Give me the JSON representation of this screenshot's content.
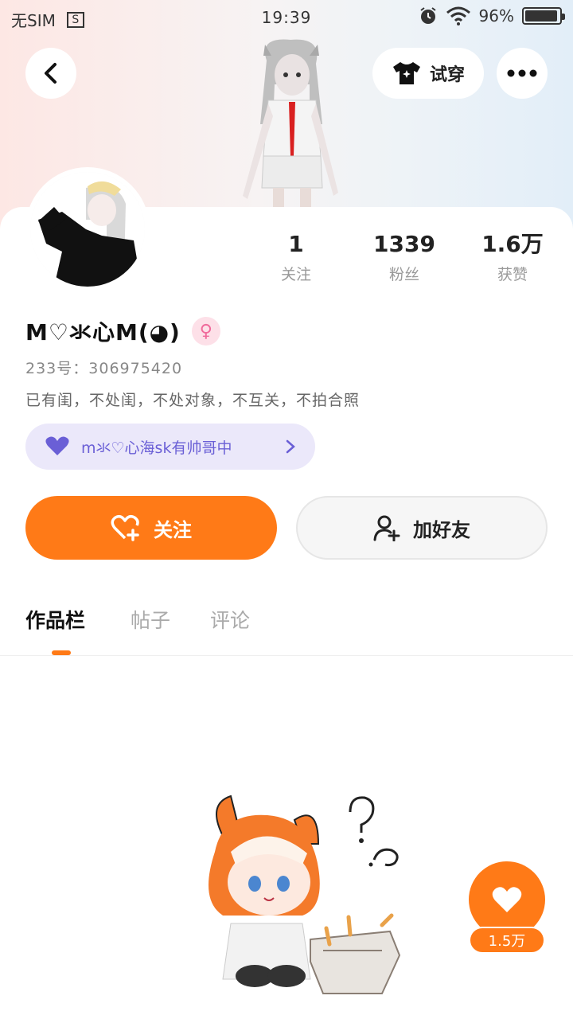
{
  "status_bar": {
    "sim": "无SIM",
    "time": "19:39",
    "battery": "96%"
  },
  "header": {
    "back_icon": "chevron-left-icon",
    "try_on_label": "试穿",
    "more_icon": "more-dots-icon"
  },
  "stats": [
    {
      "value": "1",
      "label": "关注"
    },
    {
      "value": "1339",
      "label": "粉丝"
    },
    {
      "value": "1.6万",
      "label": "获赞"
    }
  ],
  "profile": {
    "nickname": "M♡氺心M(◕)",
    "gender_icon": "female-icon",
    "uid": "233号：306975420",
    "bio": "已有闺，不处闺，不处对象，不互关，不拍合照",
    "fan_group": "m氺♡心海sk有帅哥中"
  },
  "actions": {
    "follow_label": "关注",
    "add_friend_label": "加好友"
  },
  "tabs": [
    "作品栏",
    "帖子",
    "评论"
  ],
  "like": {
    "count": "1.5万"
  },
  "colors": {
    "accent": "#ff7a17",
    "fan_pill_bg": "#ebe8fa",
    "fan_pill_text": "#6a5fd6",
    "gender_pink": "#f06a9b"
  }
}
